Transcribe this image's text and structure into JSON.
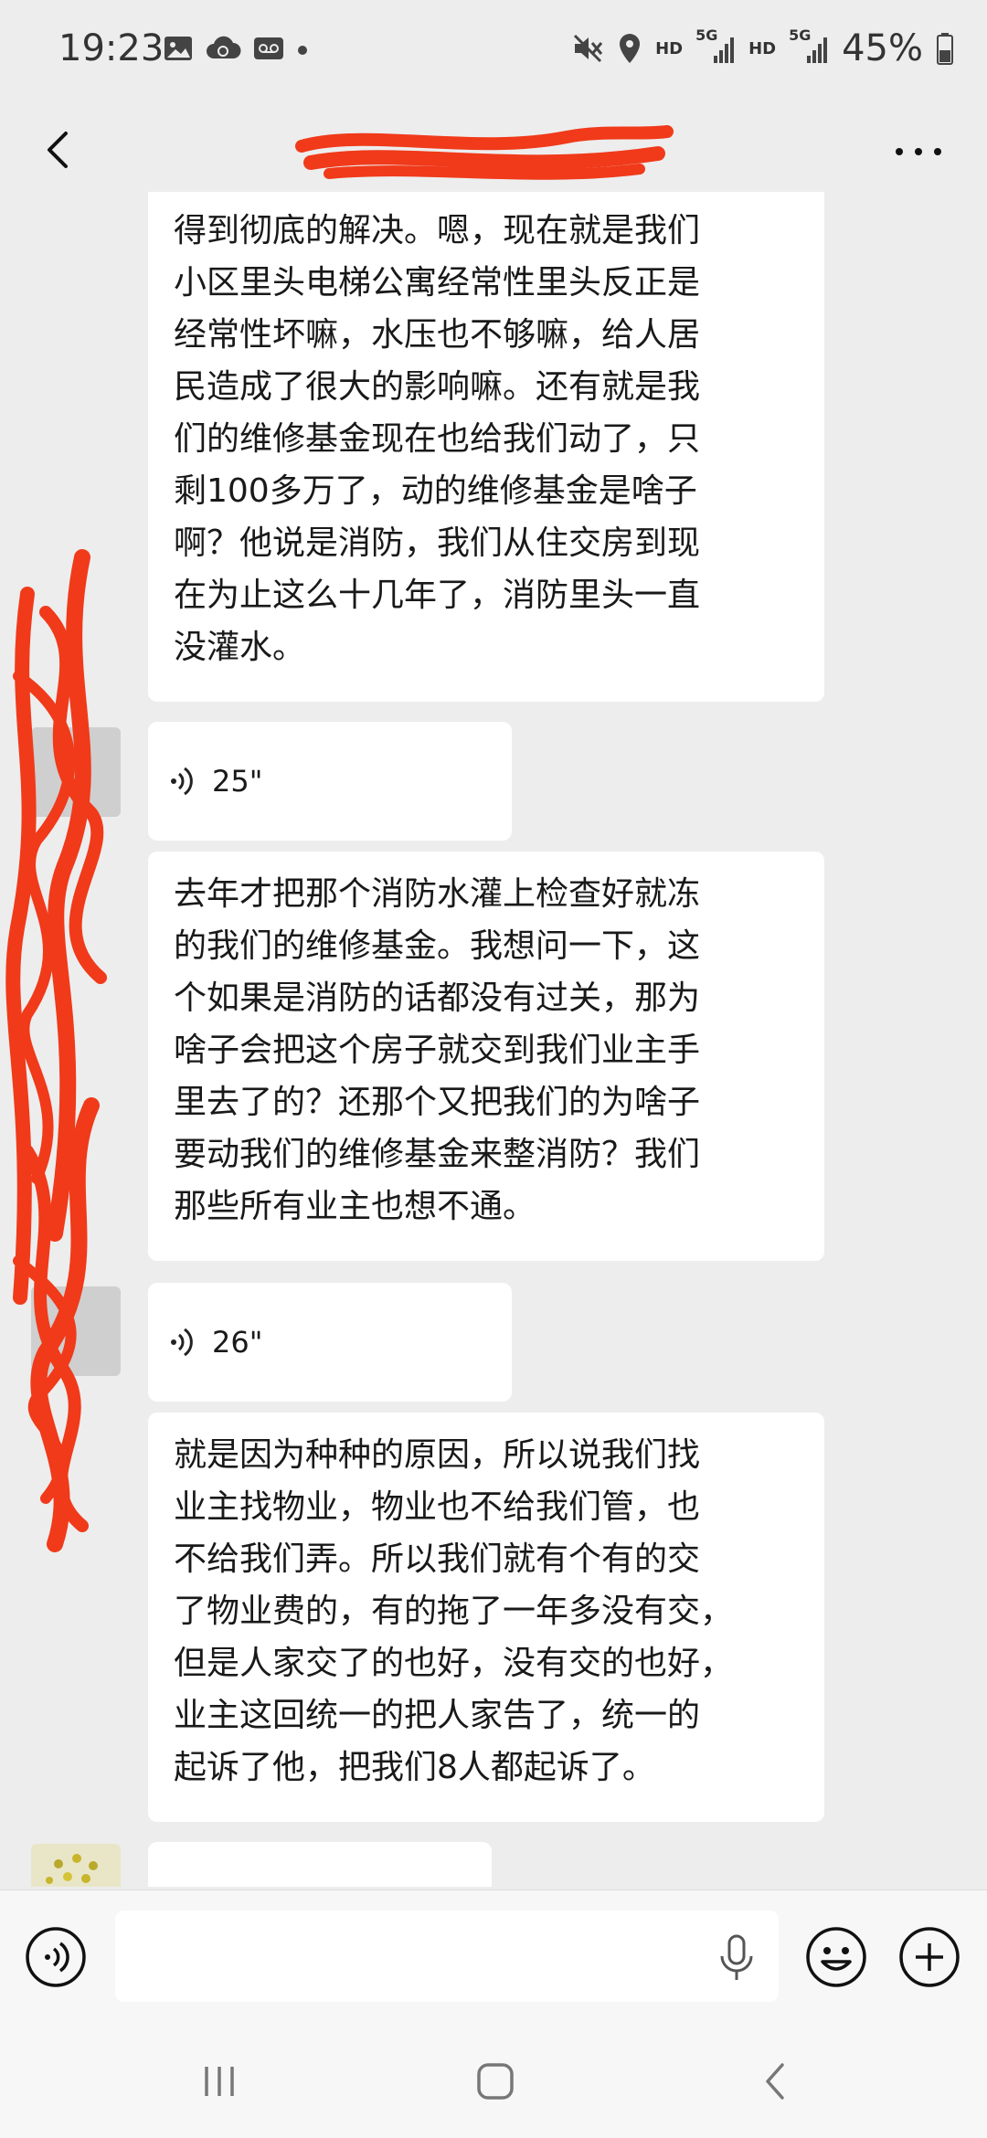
{
  "status_bar": {
    "time": "19:23",
    "battery": "45%",
    "network_tags": [
      "HD",
      "5G",
      "HD",
      "5G"
    ],
    "icons": [
      "image-icon",
      "cloud-sync-icon",
      "voicemail-icon",
      "dot-icon",
      "mute-icon",
      "location-icon",
      "signal-icon",
      "battery-icon"
    ]
  },
  "header": {
    "back_icon": "chevron-left-icon",
    "more_icon": "ellipsis-icon"
  },
  "messages": [
    {
      "type": "text",
      "text": "得到彻底的解决。嗯，现在就是我们\n小区里头电梯公寓经常性里头反正是\n经常性坏嘛，水压也不够嘛，给人居\n民造成了很大的影响嘛。还有就是我\n们的维修基金现在也给我们动了，只\n剩100多万了，动的维修基金是啥子\n啊？他说是消防，我们从住交房到现\n在为止这么十几年了，消防里头一直\n没灌水。"
    },
    {
      "type": "voice",
      "duration": "25\""
    },
    {
      "type": "text",
      "text": "去年才把那个消防水灌上检查好就冻\n的我们的维修基金。我想问一下，这\n个如果是消防的话都没有过关，那为\n啥子会把这个房子就交到我们业主手\n里去了的？还那个又把我们的为啥子\n要动我们的维修基金来整消防？我们\n那些所有业主也想不通。"
    },
    {
      "type": "voice",
      "duration": "26\""
    },
    {
      "type": "text",
      "text": "就是因为种种的原因，所以说我们找\n业主找物业，物业也不给我们管，也\n不给我们弄。所以我们就有个有的交\n了物业费的，有的拖了一年多没有交，\n但是人家交了的也好，没有交的也好，\n业主这回统一的把人家告了，统一的\n起诉了他，把我们8人都起诉了。"
    }
  ],
  "input_bar": {
    "placeholder": "",
    "voice_toggle_icon": "voice-mode-icon",
    "mic_icon": "microphone-icon",
    "emoji_icon": "emoji-icon",
    "add_icon": "plus-circle-icon"
  },
  "nav_bar": {
    "icons": [
      "recent-apps-icon",
      "home-icon",
      "back-icon"
    ]
  },
  "colors": {
    "background": "#ededed",
    "bubble": "#ffffff",
    "redaction": "#f03a1a"
  }
}
